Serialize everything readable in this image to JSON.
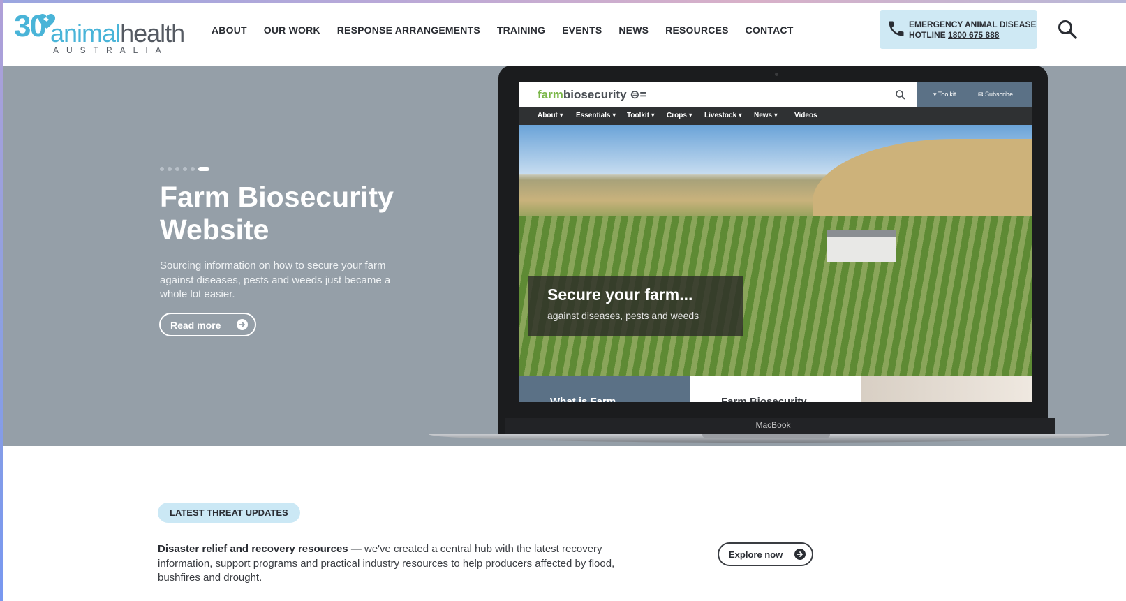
{
  "brand": {
    "logo_number": "30",
    "logo_word_a": "animal",
    "logo_word_b": "health",
    "logo_sub": "AUSTRALIA"
  },
  "nav": {
    "items": [
      "ABOUT",
      "OUR WORK",
      "RESPONSE ARRANGEMENTS",
      "TRAINING",
      "EVENTS",
      "NEWS",
      "RESOURCES",
      "CONTACT"
    ]
  },
  "hotline": {
    "line1": "EMERGENCY ANIMAL DISEASE",
    "label": "HOTLINE",
    "number": "1800 675 888"
  },
  "hero": {
    "slide_count": 6,
    "active_slide": 6,
    "title": "Farm Biosecurity Website",
    "description": "Sourcing information on how to secure your farm against diseases, pests and weeds just became a whole lot easier.",
    "button": "Read more"
  },
  "laptop": {
    "brand": "MacBook",
    "screenshot": {
      "logo_green": "farm",
      "logo_dark": "biosecurity",
      "toolkit": "Toolkit",
      "subscribe": "Subscribe",
      "nav": [
        "About ▾",
        "Essentials ▾",
        "Toolkit ▾",
        "Crops ▾",
        "Livestock ▾",
        "News ▾",
        "Videos"
      ],
      "caption_title": "Secure your farm...",
      "caption_sub": "against diseases, pests and weeds",
      "tile1": "What is Farm",
      "tile2": "Farm Biosecurity"
    }
  },
  "threat": {
    "badge": "LATEST THREAT UPDATES",
    "lead": "Disaster relief and recovery resources",
    "body": " — we've created a central hub with the latest recovery information, support programs and practical industry resources to help producers affected by flood, bushfires and drought.",
    "button": "Explore now"
  },
  "colors": {
    "accent": "#49b4d8",
    "hero_bg": "#959fa8",
    "badge_bg": "#cbe8f5",
    "text_dark": "#2a2d33"
  }
}
